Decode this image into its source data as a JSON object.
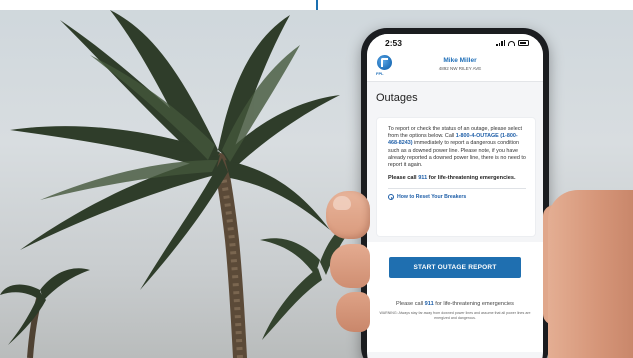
{
  "colors": {
    "brand_blue": "#1f6fb0",
    "link_blue": "#1f5fa8",
    "screen_bg": "#f4f5f7"
  },
  "status_bar": {
    "time": "2:53",
    "icons": [
      "signal-icon",
      "wifi-icon",
      "battery-icon"
    ]
  },
  "header": {
    "logo_text": "FPL",
    "account_name": "Mike Miller",
    "account_address": "4892 NW RILEY AVE"
  },
  "page": {
    "title": "Outages"
  },
  "card": {
    "intro": "To report or check the status of an outage, please select from the options below. Call",
    "phone": "1-800-4-OUTAGE (1-800-468-8243)",
    "details": "immediately to report a dangerous condition such as a downed power line. Please note, if you have already reported a downed power line, there is no need to report it again.",
    "emergency_prefix": "Please call",
    "emergency_number": "911",
    "emergency_suffix": "for life-threatening emergencies.",
    "reset_link": "How to Reset Your Breakers"
  },
  "actions": {
    "start_report": "START OUTAGE REPORT"
  },
  "footer": {
    "prefix": "Please call",
    "number": "911",
    "suffix": "for life-threatening emergencies",
    "warning": "WARNING: Always stay far away from downed power lines and assume that all power lines are energized and dangerous."
  }
}
